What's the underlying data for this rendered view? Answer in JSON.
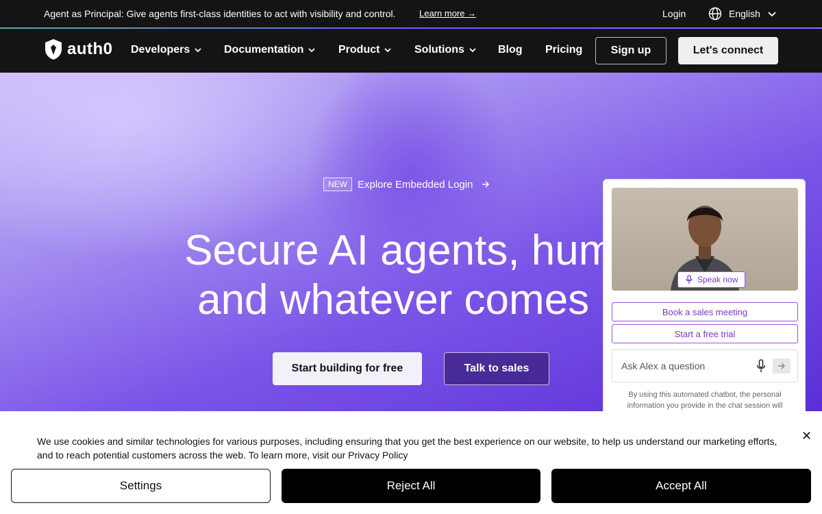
{
  "announcement": {
    "message": "Agent as Principal: Give agents first-class identities to act with visibility and control.",
    "learn_more": "Learn more →",
    "login": "Login",
    "language": "English"
  },
  "nav": {
    "logo": "auth0",
    "items": [
      {
        "label": "Developers",
        "has_dropdown": true
      },
      {
        "label": "Documentation",
        "has_dropdown": true
      },
      {
        "label": "Product",
        "has_dropdown": true
      },
      {
        "label": "Solutions",
        "has_dropdown": true
      },
      {
        "label": "Blog",
        "has_dropdown": false
      },
      {
        "label": "Pricing",
        "has_dropdown": false
      }
    ],
    "signup": "Sign up",
    "connect": "Let's connect"
  },
  "hero": {
    "badge": "NEW",
    "badge_text": "Explore Embedded Login",
    "headline_line1": "Secure AI agents, huma",
    "headline_line2": "and whatever comes n",
    "cta_primary": "Start building for free",
    "cta_secondary": "Talk to sales"
  },
  "chat": {
    "speak_now": "Speak now",
    "option1": "Book a sales meeting",
    "option2": "Start a free trial",
    "input_placeholder": "Ask Alex a question",
    "disclaimer": "By using this automated chatbot, the personal information you provide in the chat session will"
  },
  "cookie": {
    "text": "We use cookies and similar technologies for various purposes, including ensuring that you get the best experience on our website, to help us understand our marketing efforts, and to reach potential customers across the web. To learn more, visit our Privacy Policy",
    "close": "✕",
    "settings": "Settings",
    "reject": "Reject All",
    "accept": "Accept All"
  },
  "colors": {
    "dark_bg": "#141414",
    "hero_purple": "#7b55e8",
    "chat_accent": "#9c4fe0"
  }
}
